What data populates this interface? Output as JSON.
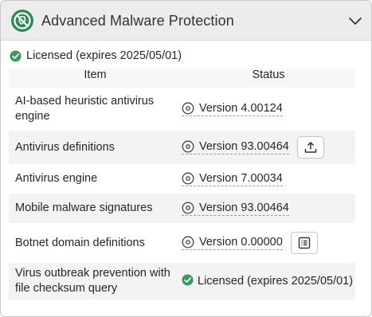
{
  "header": {
    "title": "Advanced Malware Protection"
  },
  "license": {
    "text": "Licensed (expires 2025/05/01)"
  },
  "table": {
    "columns": [
      "Item",
      "Status"
    ],
    "rows": [
      {
        "item": "AI-based heuristic antivirus engine",
        "status": "Version 4.00124"
      },
      {
        "item": "Antivirus definitions",
        "status": "Version 93.00464"
      },
      {
        "item": "Antivirus engine",
        "status": "Version 7.00034"
      },
      {
        "item": "Mobile malware signatures",
        "status": "Version 93.00464"
      },
      {
        "item": "Botnet domain definitions",
        "status": "Version 0.00000"
      },
      {
        "item": "Virus outbreak prevention with file checksum query",
        "status": "Licensed (expires 2025/05/01)"
      }
    ]
  },
  "colors": {
    "header_bg": "#ececec",
    "icon_green": "#2e8b57",
    "licensed_green": "#3a9a5c"
  },
  "icons": [
    "no-virus-shield-icon",
    "chevron-down-icon",
    "check-circle-icon",
    "version-disc-icon",
    "upload-icon",
    "list-icon"
  ]
}
